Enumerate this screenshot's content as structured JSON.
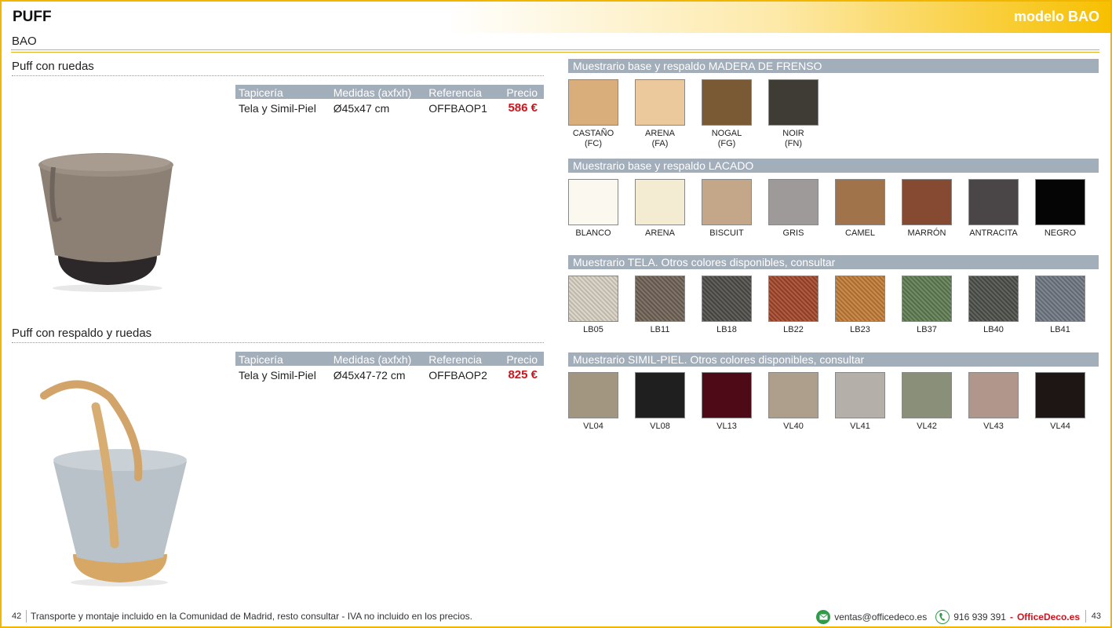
{
  "header": {
    "title": "PUFF",
    "model": "modelo BAO"
  },
  "subtitle": "BAO",
  "products": [
    {
      "title": "Puff con ruedas",
      "columns": [
        "Tapicería",
        "Medidas (axfxh)",
        "Referencia",
        "Precio"
      ],
      "row": {
        "tapiceria": "Tela y Simil-Piel",
        "medidas": "Ø45x47 cm",
        "referencia": "OFFBAOP1",
        "precio": "586 €"
      }
    },
    {
      "title": "Puff con respaldo y ruedas",
      "columns": [
        "Tapicería",
        "Medidas (axfxh)",
        "Referencia",
        "Precio"
      ],
      "row": {
        "tapiceria": "Tela y Simil-Piel",
        "medidas": "Ø45x47-72 cm",
        "referencia": "OFFBAOP2",
        "precio": "825 €"
      }
    }
  ],
  "swatch_groups": [
    {
      "title": "Muestrario base y respaldo MADERA DE FRENSO",
      "items": [
        {
          "name": "CASTAÑO",
          "code": "(FC)",
          "color": "#d9ae7a"
        },
        {
          "name": "ARENA",
          "code": "(FA)",
          "color": "#ecc89d"
        },
        {
          "name": "NOGAL",
          "code": "(FG)",
          "color": "#7a5a35"
        },
        {
          "name": "NOIR",
          "code": "(FN)",
          "color": "#3f3c35"
        }
      ]
    },
    {
      "title": "Muestrario base y respaldo LACADO",
      "items": [
        {
          "name": "BLANCO",
          "color": "#fbf9ef"
        },
        {
          "name": "ARENA",
          "color": "#f4ecd2"
        },
        {
          "name": "BISCUIT",
          "color": "#c4a689"
        },
        {
          "name": "GRIS",
          "color": "#9d9a99"
        },
        {
          "name": "CAMEL",
          "color": "#a0734a"
        },
        {
          "name": "MARRÓN",
          "color": "#854a31"
        },
        {
          "name": "ANTRACITA",
          "color": "#4a4647"
        },
        {
          "name": "NEGRO",
          "color": "#050505"
        }
      ]
    },
    {
      "title": "Muestrario TELA. Otros colores disponibles, consultar",
      "items": [
        {
          "name": "LB05",
          "color": "#d8d0c4"
        },
        {
          "name": "LB11",
          "color": "#6f6255"
        },
        {
          "name": "LB18",
          "color": "#4e4c48"
        },
        {
          "name": "LB22",
          "color": "#a3472a"
        },
        {
          "name": "LB23",
          "color": "#c37b36"
        },
        {
          "name": "LB37",
          "color": "#5e7c53"
        },
        {
          "name": "LB40",
          "color": "#4c4f4a"
        },
        {
          "name": "LB41",
          "color": "#6e7681"
        }
      ]
    },
    {
      "title": "Muestrario SIMIL-PIEL. Otros colores disponibles, consultar",
      "items": [
        {
          "name": "VL04",
          "color": "#a39680"
        },
        {
          "name": "VL08",
          "color": "#1f1f20"
        },
        {
          "name": "VL13",
          "color": "#4e0a17"
        },
        {
          "name": "VL40",
          "color": "#ae9f8c"
        },
        {
          "name": "VL41",
          "color": "#b4afa8"
        },
        {
          "name": "VL42",
          "color": "#8a8f7a"
        },
        {
          "name": "VL43",
          "color": "#b1968b"
        },
        {
          "name": "VL44",
          "color": "#1e1615"
        }
      ]
    }
  ],
  "footer": {
    "page_left": "42",
    "note": "Transporte y montaje incluido en la Comunidad de Madrid, resto consultar - IVA no incluido en los precios.",
    "email": "ventas@officedeco.es",
    "phone": "916 939 391",
    "separator": "-",
    "brand": "OfficeDeco.es",
    "page_right": "43",
    "email_icon": "email-icon",
    "phone_icon": "phone-icon"
  }
}
